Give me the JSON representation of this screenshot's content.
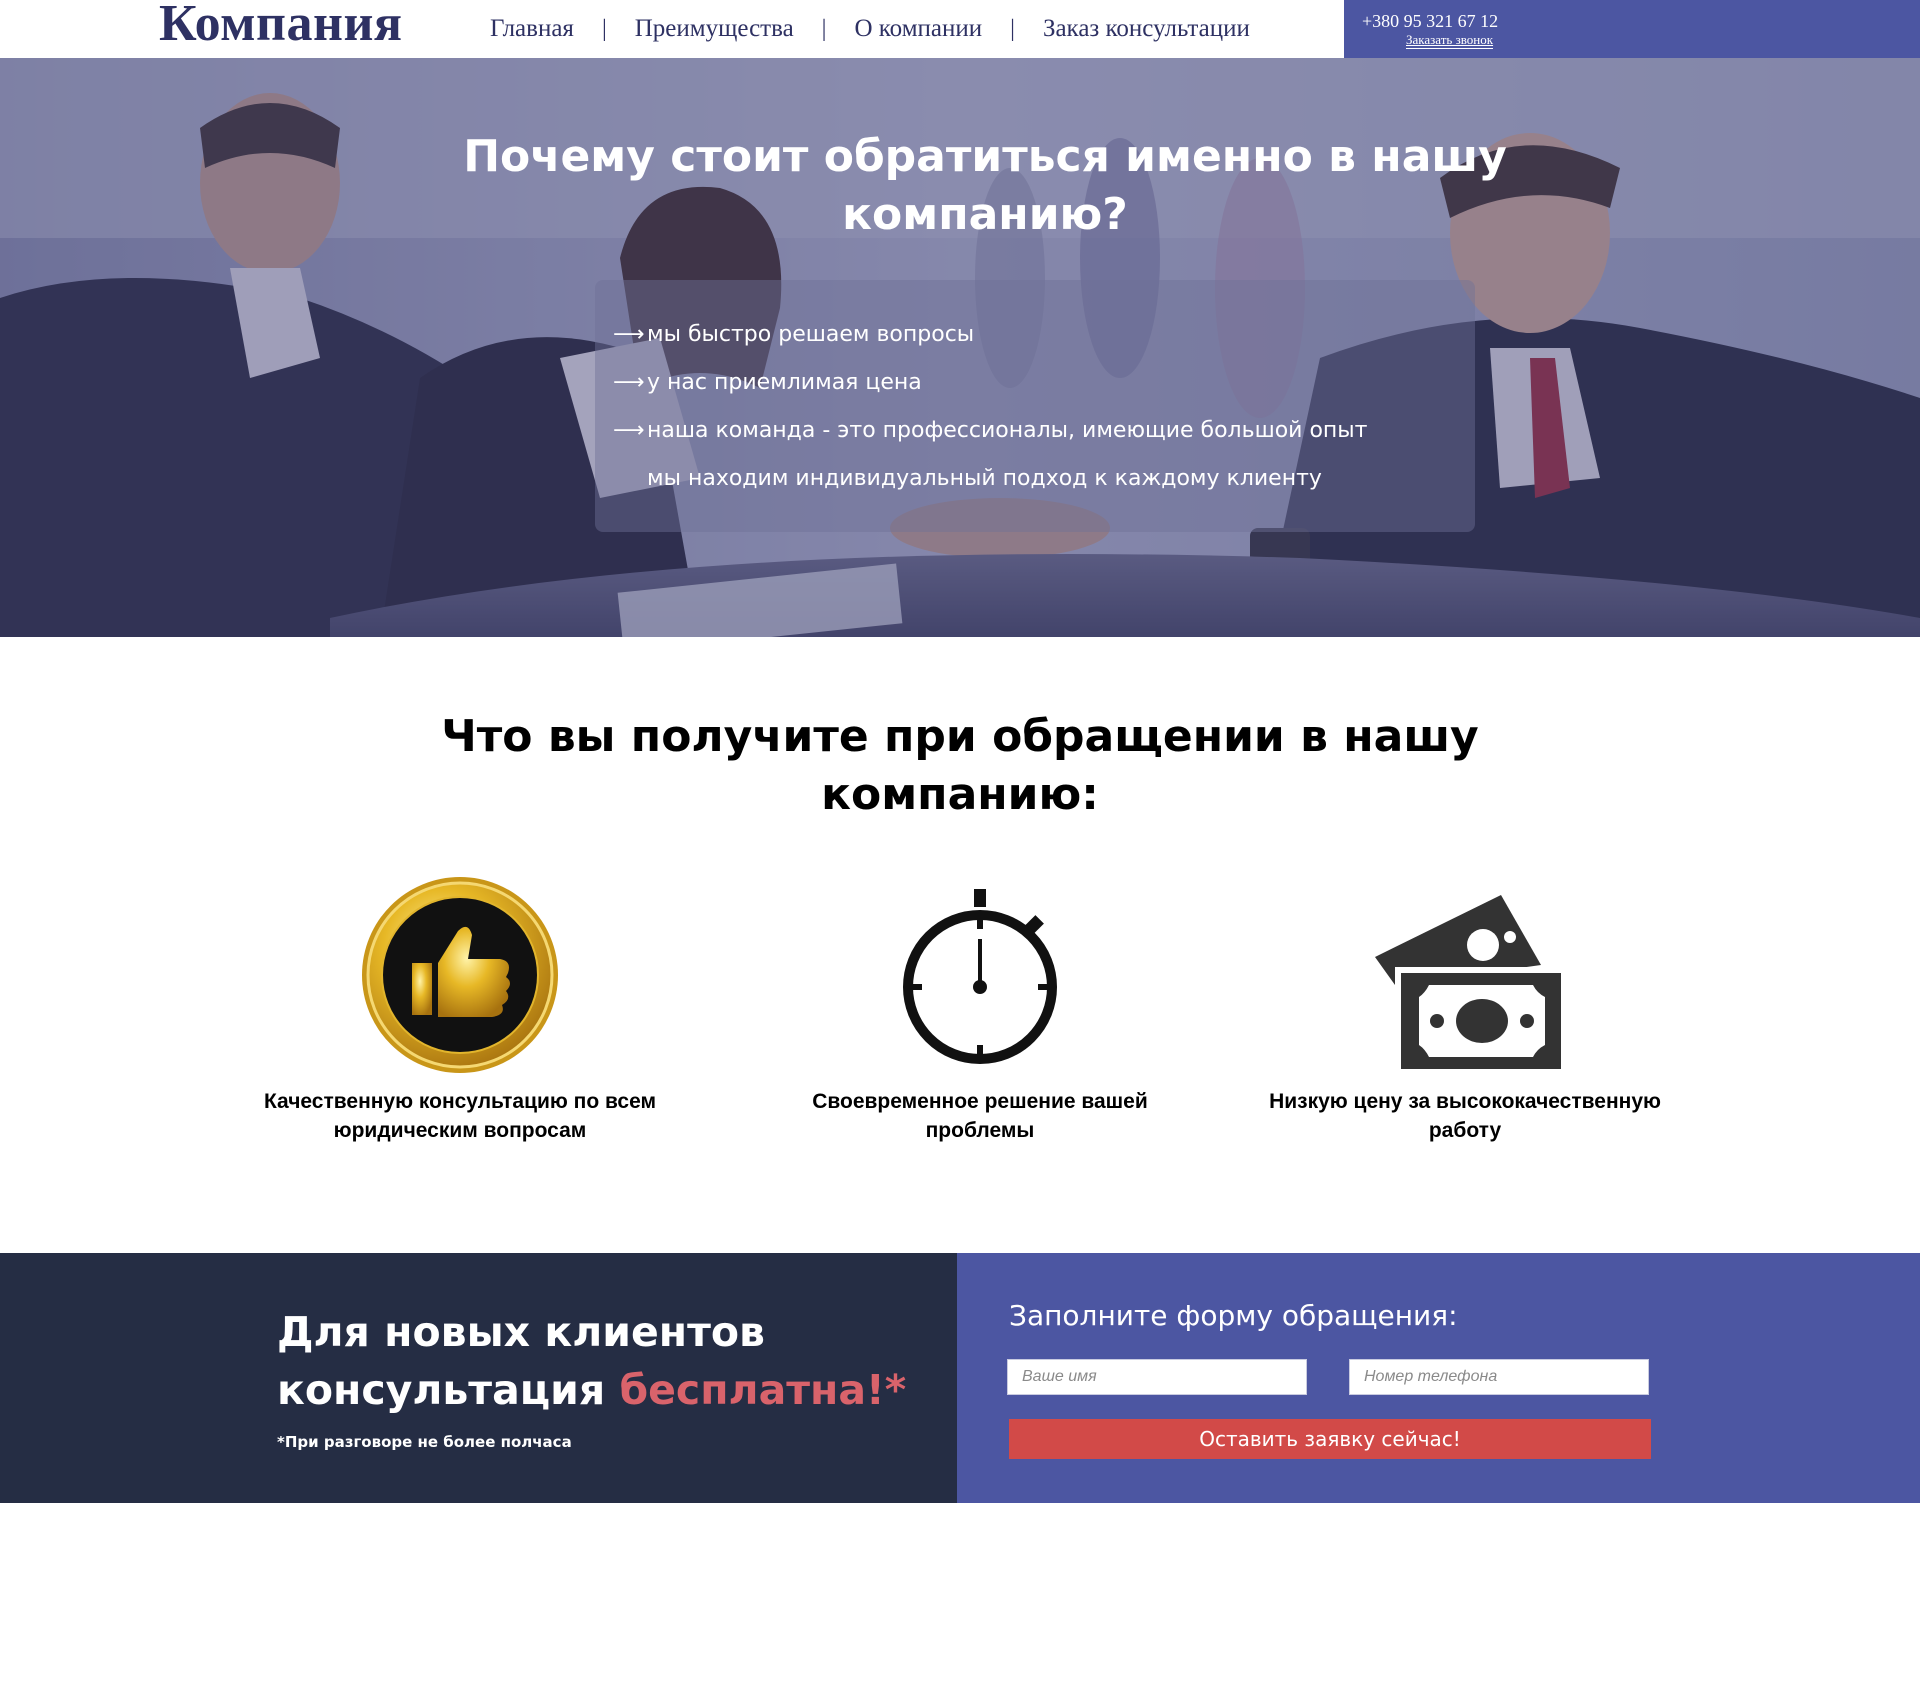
{
  "header": {
    "logo": "Компания",
    "nav": [
      {
        "label": "Главная"
      },
      {
        "label": "Преимущества"
      },
      {
        "label": "О компании"
      },
      {
        "label": "Заказ консультации"
      }
    ],
    "separator": "|",
    "phone": "+380 95 321 67 12",
    "callback": "Заказать звонок"
  },
  "hero": {
    "title": "Почему стоит обратиться именно в нашу компанию?",
    "arrow": "⟶",
    "points": [
      "мы быстро решаем вопросы",
      "у нас приемлимая цена",
      "наша команда - это профессионалы, имеющие большой опыт",
      "мы находим индивидуальный подход к каждому клиенту"
    ]
  },
  "benefits": {
    "title": "Что вы получите при обращении в нашу компанию:",
    "items": [
      {
        "icon": "thumbs-up-seal-icon",
        "label": "Качественную консультацию по всем юридическим вопросам"
      },
      {
        "icon": "stopwatch-icon",
        "label": "Своевременное решение вашей проблемы"
      },
      {
        "icon": "money-bills-icon",
        "label": "Низкую цену за высококачественную работу"
      }
    ]
  },
  "cta": {
    "title_line1": "Для новых клиентов",
    "title_line2_start": "консультация ",
    "title_accent": "бесплатна!*",
    "note": "*При разговоре не более полчаса",
    "form_title": "Заполните форму обращения:",
    "name_placeholder": "Ваше имя",
    "phone_placeholder": "Номер телефона",
    "submit_label": "Оставить заявку сейчас!"
  },
  "colors": {
    "brand": "#2e3163",
    "accent_blue": "#4c56a2",
    "dark_navy": "#252d44",
    "accent_red": "#d24a48",
    "accent_pink": "#d9636b"
  }
}
